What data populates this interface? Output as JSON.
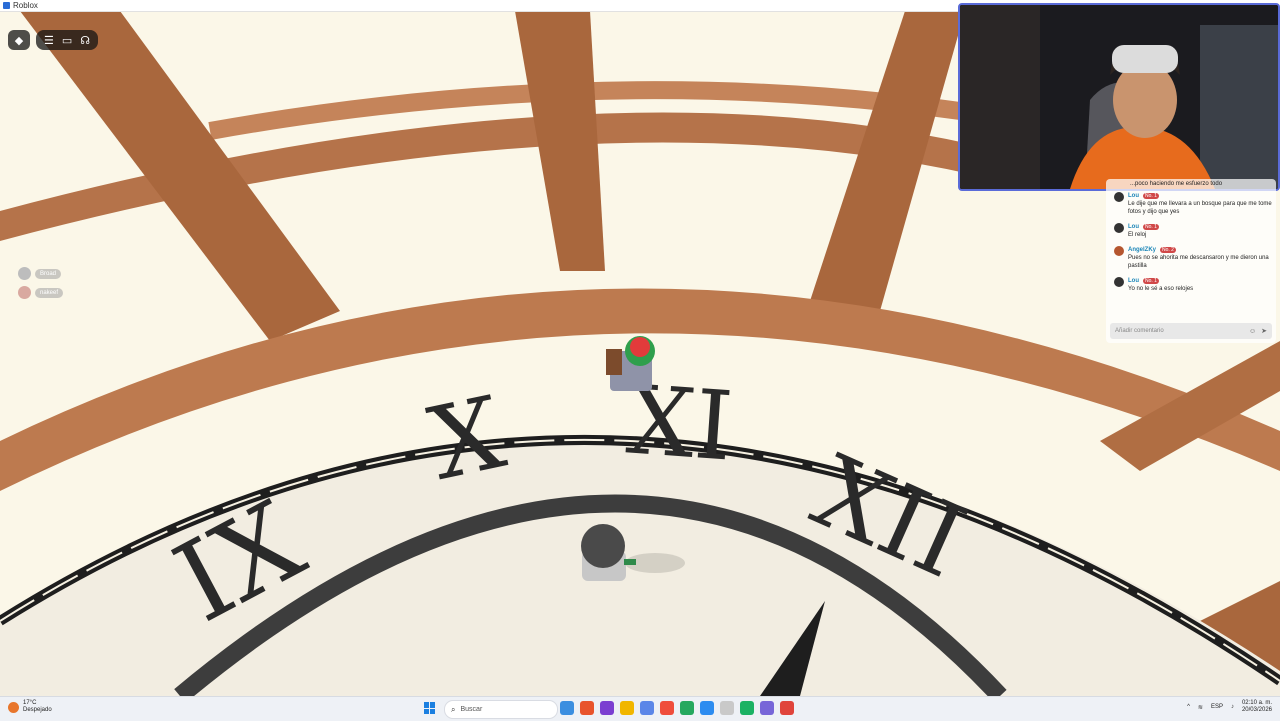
{
  "window": {
    "title": "Roblox"
  },
  "roblox": {
    "topbar": {
      "logo_icon": "roblox-logo-icon",
      "menu_icon": "hamburger-icon",
      "chat_icon": "chat-bubble-icon",
      "voice_icon": "headset-icon"
    },
    "players": [
      {
        "name": "Broad"
      },
      {
        "name": "nakeef"
      }
    ],
    "clock_numerals": [
      "IX",
      "X",
      "XI",
      "XII"
    ]
  },
  "chat": {
    "top_fragment": "...poco haciendo me esfuerzo todo",
    "messages": [
      {
        "user": "Lou",
        "badge": "No. 1",
        "text": "Le dije que me llevara a un bosque para que me tome fotos y dijo que yes"
      },
      {
        "user": "Lou",
        "badge": "No. 1",
        "text": "El reloj"
      },
      {
        "user": "AngelZKy",
        "badge": "No. 2",
        "text": "Pues no se ahorita me descansaron y me dieron una pastilla"
      },
      {
        "user": "Lou",
        "badge": "No. 1",
        "text": "Yo no le sé a eso relojes"
      }
    ],
    "input_placeholder": "Añadir comentario"
  },
  "taskbar": {
    "weather_temp": "17°C",
    "weather_desc": "Despejado",
    "search_label": "Buscar",
    "language": "ESP",
    "time": "02:10 a. m.",
    "date": "20/03/2026",
    "icon_colors": [
      "#3b8ee0",
      "#e8542d",
      "#7b3fd1",
      "#f1b600",
      "#5b86e8",
      "#ef4d3c",
      "#25a85f",
      "#2d8cf0",
      "#c9c9c9",
      "#1bb264",
      "#7766d8",
      "#e0443b"
    ]
  },
  "colors": {
    "beam": "#b9764a",
    "beam_dark": "#8f5530",
    "face": "#f2ede1",
    "numeral": "#2a2a2a",
    "rail": "#1e1e1e"
  }
}
